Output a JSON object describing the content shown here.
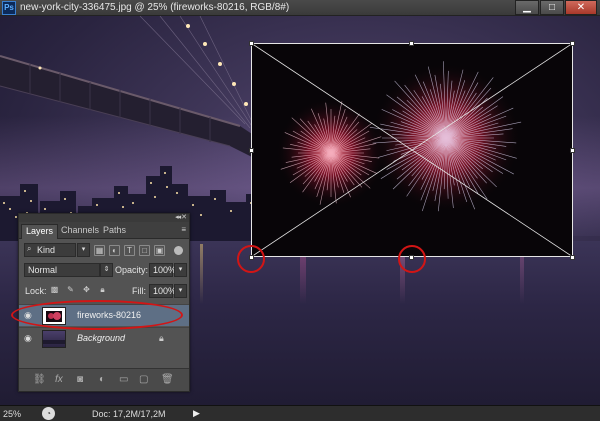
{
  "window": {
    "app_icon": "Ps",
    "title": "new-york-city-336475.jpg @ 25% (fireworks-80216, RGB/8#)",
    "minimize": "▁",
    "maximize": "□",
    "close": "✕"
  },
  "status": {
    "zoom": "25%",
    "doc_info": "Doc: 17,2M/17,2M",
    "arrow": "▶"
  },
  "layers_panel": {
    "tabs": [
      "Layers",
      "Channels",
      "Paths"
    ],
    "active_tab": "Layers",
    "filter_kind": "Kind",
    "blend_mode": "Normal",
    "opacity_label": "Opacity:",
    "opacity_value": "100%",
    "lock_label": "Lock:",
    "fill_label": "Fill:",
    "fill_value": "100%",
    "layers": [
      {
        "name": "fireworks-80216",
        "selected": true,
        "locked": false
      },
      {
        "name": "Background",
        "selected": false,
        "locked": true
      }
    ],
    "bottom_icons": [
      "link-icon",
      "fx-icon",
      "mask-icon",
      "adjustment-icon",
      "group-icon",
      "new-layer-icon",
      "trash-icon"
    ]
  },
  "colors": {
    "selection_highlight": "#5e6f85",
    "annotation_red": "#d21515"
  }
}
